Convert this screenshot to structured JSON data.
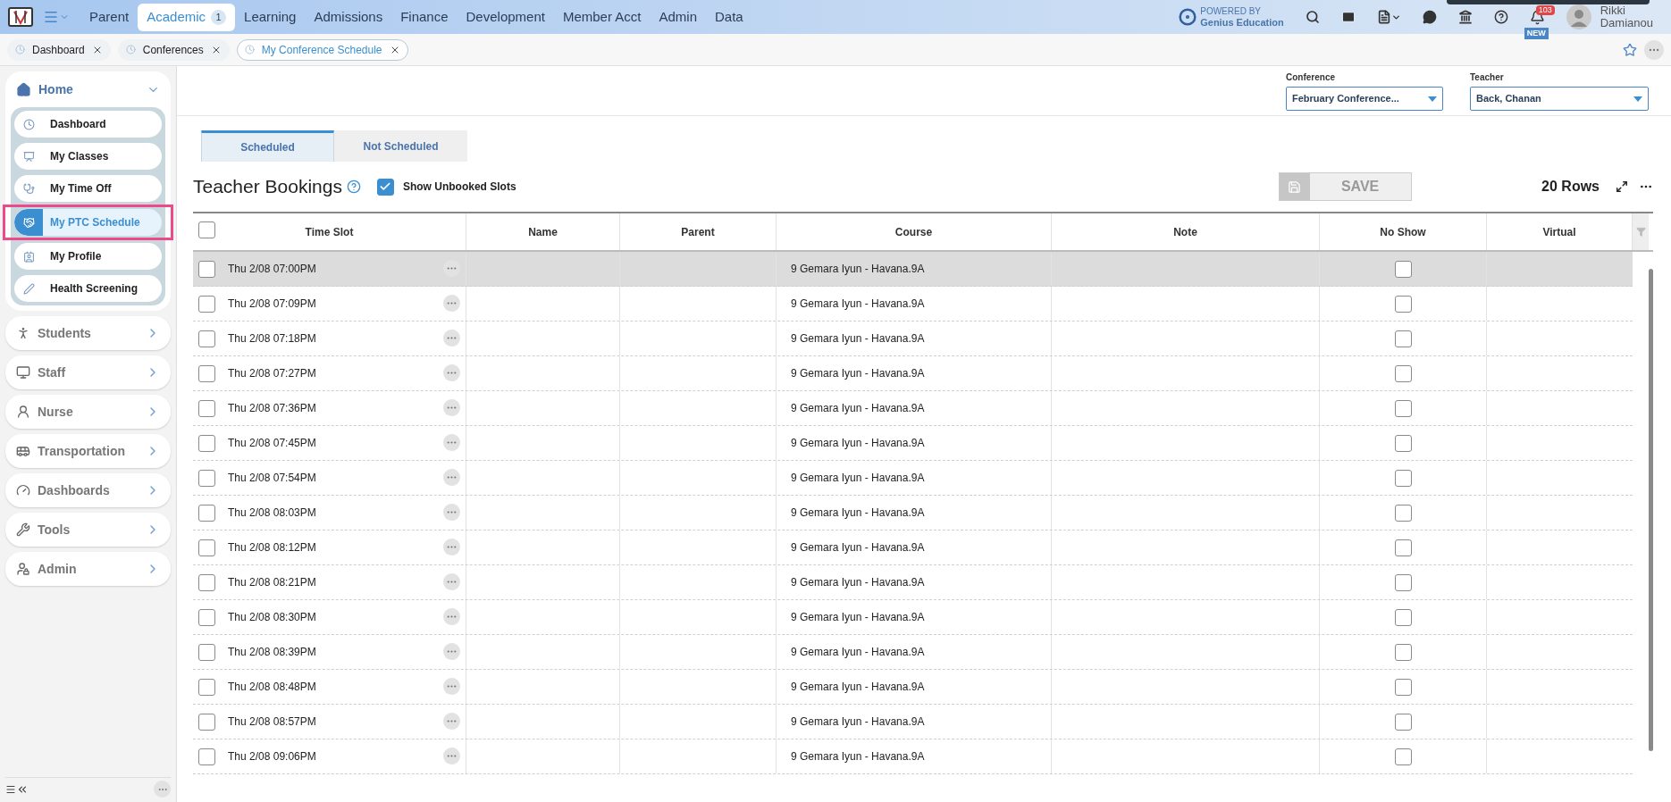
{
  "top_nav": {
    "items": [
      {
        "label": "Parent",
        "selected": false
      },
      {
        "label": "Academic",
        "selected": true,
        "badge": "1"
      },
      {
        "label": "Learning",
        "selected": false
      },
      {
        "label": "Admissions",
        "selected": false
      },
      {
        "label": "Finance",
        "selected": false
      },
      {
        "label": "Development",
        "selected": false
      },
      {
        "label": "Member Acct",
        "selected": false
      },
      {
        "label": "Admin",
        "selected": false
      },
      {
        "label": "Data",
        "selected": false
      }
    ],
    "powered_by": "POWERED BY",
    "brand": "Genius Education",
    "notification_count": "103",
    "new_label": "NEW",
    "user": {
      "first_name": "Rikki",
      "last_name": "Damianou"
    }
  },
  "open_tabs": [
    {
      "label": "Dashboard",
      "selected": false
    },
    {
      "label": "Conferences",
      "selected": false
    },
    {
      "label": "My Conference Schedule",
      "selected": true
    }
  ],
  "sidebar": {
    "sections": [
      {
        "label": "Home",
        "expanded": true,
        "children": [
          {
            "label": "Dashboard",
            "selected": false
          },
          {
            "label": "My Classes",
            "selected": false
          },
          {
            "label": "My Time Off",
            "selected": false
          },
          {
            "label": "My PTC Schedule",
            "selected": true,
            "highlighted": true
          },
          {
            "label": "My Profile",
            "selected": false
          },
          {
            "label": "Health Screening",
            "selected": false
          }
        ]
      },
      {
        "label": "Students",
        "expanded": false
      },
      {
        "label": "Staff",
        "expanded": false
      },
      {
        "label": "Nurse",
        "expanded": false
      },
      {
        "label": "Transportation",
        "expanded": false
      },
      {
        "label": "Dashboards",
        "expanded": false
      },
      {
        "label": "Tools",
        "expanded": false
      },
      {
        "label": "Admin",
        "expanded": false
      }
    ]
  },
  "filters": [
    {
      "label": "Conference",
      "value": "February Conference..."
    },
    {
      "label": "Teacher",
      "value": "Back, Chanan"
    }
  ],
  "view_tabs": [
    {
      "label": "Scheduled",
      "selected": true
    },
    {
      "label": "Not Scheduled",
      "selected": false
    }
  ],
  "title": "Teacher Bookings",
  "show_unbooked": {
    "label": "Show Unbooked Slots",
    "checked": true
  },
  "save_button": {
    "label": "SAVE",
    "disabled": true
  },
  "row_count": "20 Rows",
  "table": {
    "all_checked": false,
    "columns": [
      "Time Slot",
      "Name",
      "Parent",
      "Course",
      "Note",
      "No Show",
      "Virtual"
    ],
    "rows": [
      {
        "time_slot": "Thu 2/08 07:00PM",
        "course": "9 Gemara Iyun - Havana.9A",
        "selected": true,
        "checked": false,
        "no_show": false
      },
      {
        "time_slot": "Thu 2/08 07:09PM",
        "course": "9 Gemara Iyun - Havana.9A",
        "selected": false,
        "checked": false,
        "no_show": false
      },
      {
        "time_slot": "Thu 2/08 07:18PM",
        "course": "9 Gemara Iyun - Havana.9A",
        "selected": false,
        "checked": false,
        "no_show": false
      },
      {
        "time_slot": "Thu 2/08 07:27PM",
        "course": "9 Gemara Iyun - Havana.9A",
        "selected": false,
        "checked": false,
        "no_show": false
      },
      {
        "time_slot": "Thu 2/08 07:36PM",
        "course": "9 Gemara Iyun - Havana.9A",
        "selected": false,
        "checked": false,
        "no_show": false
      },
      {
        "time_slot": "Thu 2/08 07:45PM",
        "course": "9 Gemara Iyun - Havana.9A",
        "selected": false,
        "checked": false,
        "no_show": false
      },
      {
        "time_slot": "Thu 2/08 07:54PM",
        "course": "9 Gemara Iyun - Havana.9A",
        "selected": false,
        "checked": false,
        "no_show": false
      },
      {
        "time_slot": "Thu 2/08 08:03PM",
        "course": "9 Gemara Iyun - Havana.9A",
        "selected": false,
        "checked": false,
        "no_show": false
      },
      {
        "time_slot": "Thu 2/08 08:12PM",
        "course": "9 Gemara Iyun - Havana.9A",
        "selected": false,
        "checked": false,
        "no_show": false
      },
      {
        "time_slot": "Thu 2/08 08:21PM",
        "course": "9 Gemara Iyun - Havana.9A",
        "selected": false,
        "checked": false,
        "no_show": false
      },
      {
        "time_slot": "Thu 2/08 08:30PM",
        "course": "9 Gemara Iyun - Havana.9A",
        "selected": false,
        "checked": false,
        "no_show": false
      },
      {
        "time_slot": "Thu 2/08 08:39PM",
        "course": "9 Gemara Iyun - Havana.9A",
        "selected": false,
        "checked": false,
        "no_show": false
      },
      {
        "time_slot": "Thu 2/08 08:48PM",
        "course": "9 Gemara Iyun - Havana.9A",
        "selected": false,
        "checked": false,
        "no_show": false
      },
      {
        "time_slot": "Thu 2/08 08:57PM",
        "course": "9 Gemara Iyun - Havana.9A",
        "selected": false,
        "checked": false,
        "no_show": false
      },
      {
        "time_slot": "Thu 2/08 09:06PM",
        "course": "9 Gemara Iyun - Havana.9A",
        "selected": false,
        "checked": false,
        "no_show": false
      }
    ]
  }
}
